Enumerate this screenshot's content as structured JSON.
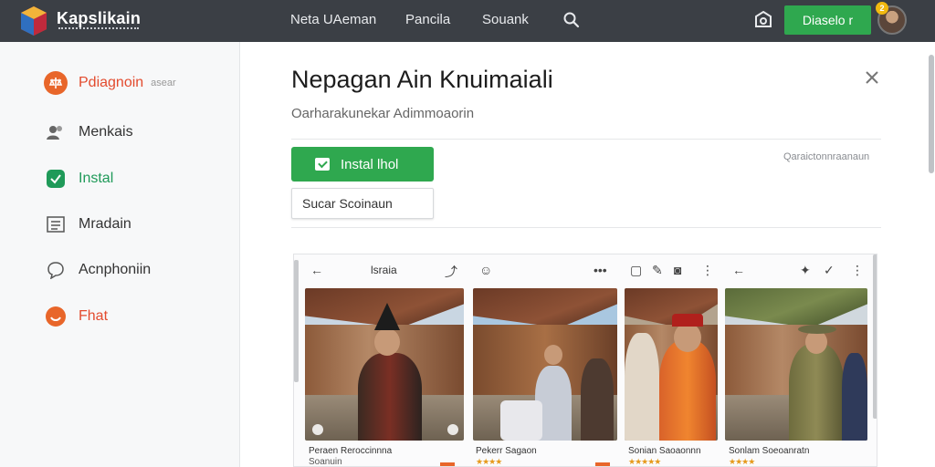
{
  "header": {
    "brand": "Kapslikain",
    "nav": [
      "Neta UAeman",
      "Pancila",
      "Souank"
    ],
    "download_label": "Diaselo r",
    "badge_count": "2"
  },
  "sidebar": {
    "items": [
      {
        "label": "Pdiagnoin",
        "sub": "asear",
        "icon": "scales-icon",
        "color": "#e34b2e"
      },
      {
        "label": "Menkais",
        "icon": "users-icon",
        "color": "#333333"
      },
      {
        "label": "Instal",
        "icon": "install-icon",
        "color": "#1f9a59"
      },
      {
        "label": "Mradain",
        "icon": "list-icon",
        "color": "#333333"
      },
      {
        "label": "Acnphoniin",
        "icon": "chat-icon",
        "color": "#333333"
      },
      {
        "label": "Fhat",
        "icon": "smile-icon",
        "color": "#e34b2e"
      }
    ]
  },
  "main": {
    "title": "Nepagan Ain Knuimaiali",
    "subtitle": "Oarharakunekar Adimmoaorin",
    "install_label": "Instal lhol",
    "secondary_label": "Sucar Scoinaun",
    "side_link": "Qaraictonnraanaun"
  },
  "screens": {
    "toolbar_title": "lsraia",
    "items": [
      {
        "caption": "Peraen Reroccinnna",
        "sub": "Soanuin",
        "stars": ""
      },
      {
        "caption": "Pekerr Sagaon",
        "sub": "",
        "stars": "★★★★"
      },
      {
        "caption": "Sonian Saoaonnn",
        "sub": "",
        "stars": "★★★★★"
      },
      {
        "caption": "Sonlam Soeoanratn",
        "sub": "",
        "stars": "★★★★"
      }
    ]
  },
  "colors": {
    "topbar": "#3b3f45",
    "accent_green": "#2fa84f",
    "accent_orange": "#e8662a"
  }
}
